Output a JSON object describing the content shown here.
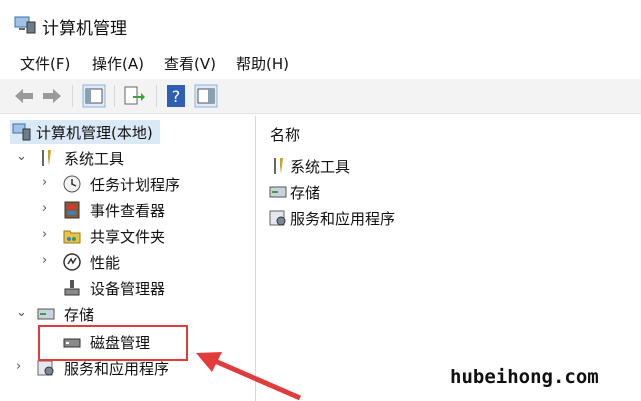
{
  "window": {
    "title": "计算机管理"
  },
  "menu": [
    "文件(F)",
    "操作(A)",
    "查看(V)",
    "帮助(H)"
  ],
  "toolbar": [
    "back-icon",
    "forward-icon",
    "show-hide-console-tree-icon",
    "export-list-icon",
    "help-icon",
    "action-pane-icon"
  ],
  "tree": {
    "root": "计算机管理(本地)",
    "system_tools": "系统工具",
    "task_scheduler": "任务计划程序",
    "event_viewer": "事件查看器",
    "shared_folders": "共享文件夹",
    "performance": "性能",
    "device_manager": "设备管理器",
    "storage": "存储",
    "disk_management": "磁盘管理",
    "services_apps": "服务和应用程序"
  },
  "content": {
    "column_name": "名称",
    "items": [
      "系统工具",
      "存储",
      "服务和应用程序"
    ]
  },
  "watermark": "hubeihong.com",
  "colors": {
    "highlight": "#e33b3b",
    "selection": "#dbe9f7"
  }
}
